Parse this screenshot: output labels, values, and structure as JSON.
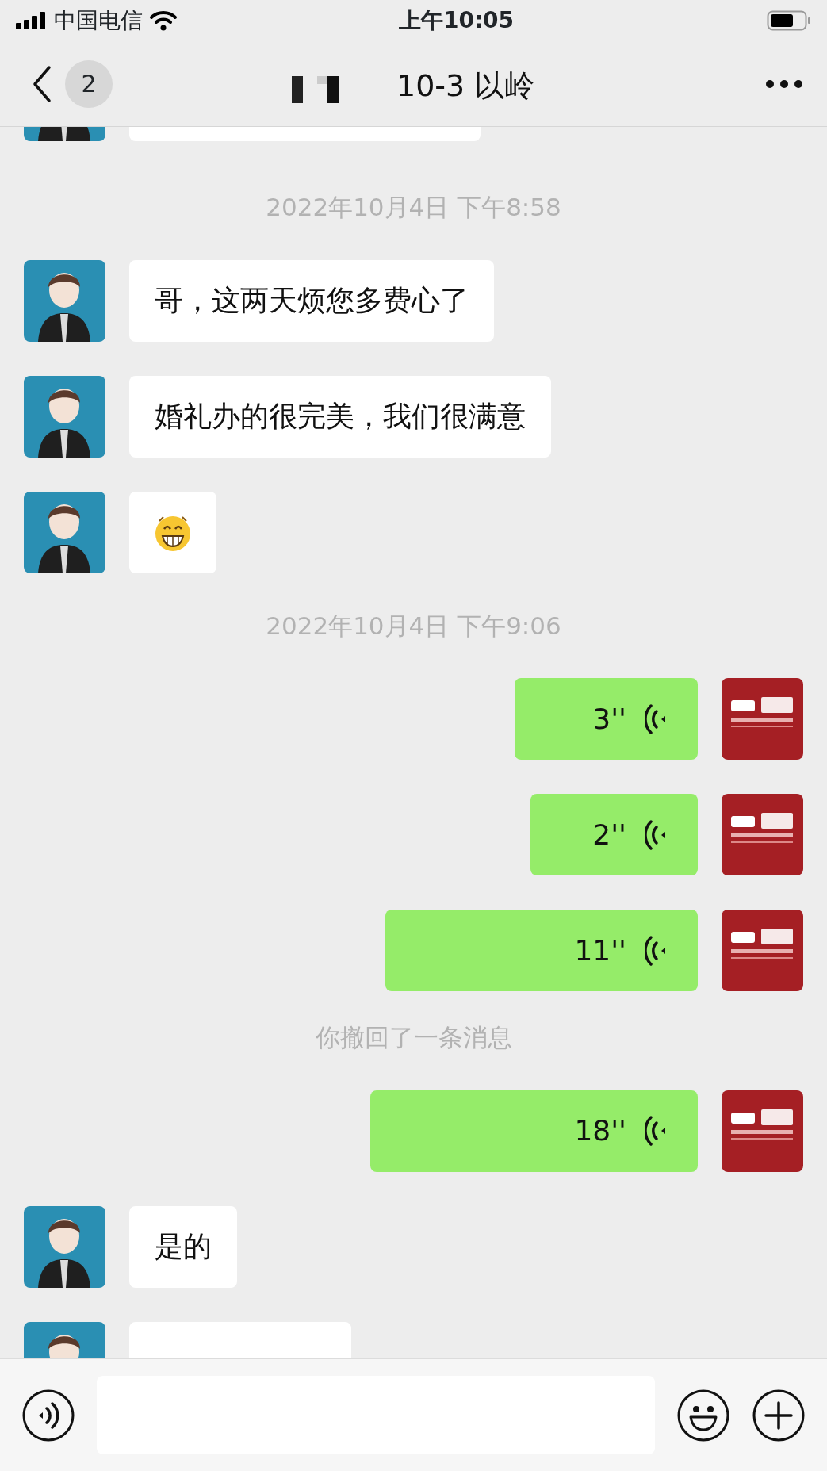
{
  "status_bar": {
    "carrier": "中国电信",
    "time": "上午10:05"
  },
  "nav": {
    "unread": "2",
    "title": "10-3 以岭"
  },
  "messages": [
    {
      "kind": "cut_top",
      "incoming": true
    },
    {
      "kind": "time",
      "text": "2022年10月4日 下午8:58"
    },
    {
      "kind": "text",
      "incoming": true,
      "text": "哥，这两天烦您多费心了"
    },
    {
      "kind": "text",
      "incoming": true,
      "text": "婚礼办的很完美，我们很满意"
    },
    {
      "kind": "emoji",
      "incoming": true
    },
    {
      "kind": "time",
      "text": "2022年10月4日 下午9:06"
    },
    {
      "kind": "voice",
      "incoming": false,
      "duration": "3''"
    },
    {
      "kind": "voice",
      "incoming": false,
      "duration": "2''"
    },
    {
      "kind": "voice",
      "incoming": false,
      "duration": "11''"
    },
    {
      "kind": "notice",
      "text": "你撤回了一条消息"
    },
    {
      "kind": "voice",
      "incoming": false,
      "duration": "18''"
    },
    {
      "kind": "text",
      "incoming": true,
      "text": "是的"
    },
    {
      "kind": "cut_bottom",
      "incoming": true
    }
  ]
}
